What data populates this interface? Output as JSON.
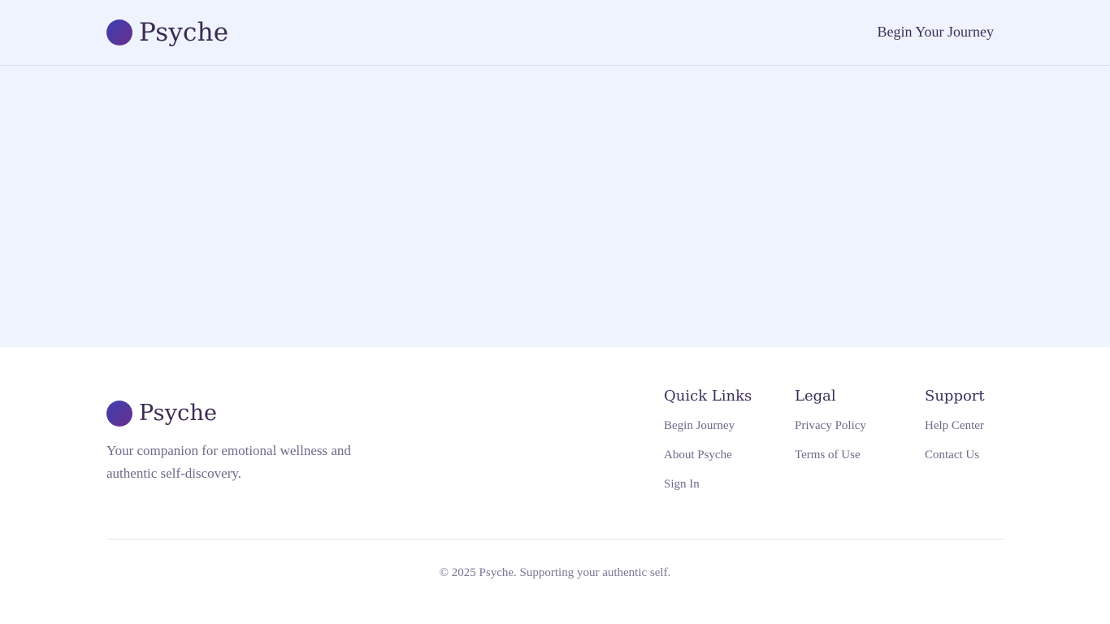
{
  "brand": {
    "name": "Psyche"
  },
  "header": {
    "cta_label": "Begin Your Journey"
  },
  "footer": {
    "tagline": "Your companion for emotional wellness and authentic self-discovery.",
    "columns": [
      {
        "title": "Quick Links",
        "links": [
          "Begin Journey",
          "About Psyche",
          "Sign In"
        ]
      },
      {
        "title": "Legal",
        "links": [
          "Privacy Policy",
          "Terms of Use"
        ]
      },
      {
        "title": "Support",
        "links": [
          "Help Center",
          "Contact Us"
        ]
      }
    ],
    "copyright": "© 2025 Psyche. Supporting your authentic self."
  },
  "colors": {
    "background": "#eef3fd",
    "brand_gradient_start": "#3a3fb0",
    "brand_gradient_end": "#6a2f8e",
    "text_primary": "#3b2a52",
    "text_muted": "#6e6a8a"
  }
}
